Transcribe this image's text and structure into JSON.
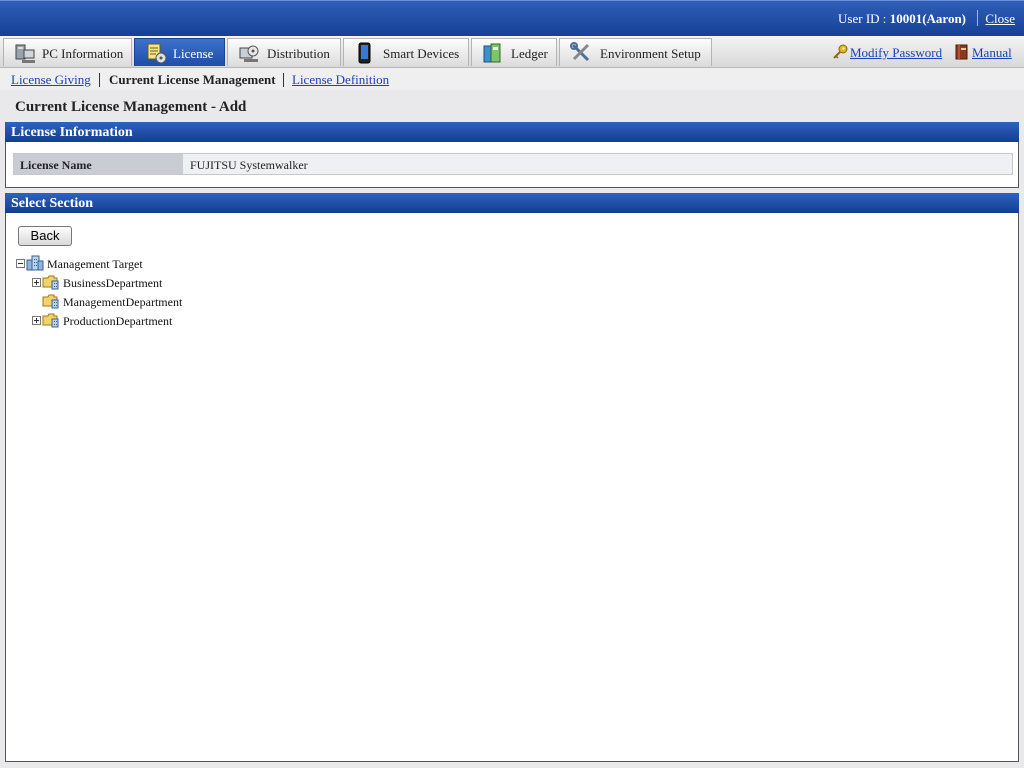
{
  "header": {
    "user_id_label": "User ID : ",
    "user_id_value": "10001(Aaron)",
    "close_label": "Close"
  },
  "tabs": [
    {
      "label": "PC Information",
      "icon": "computer-icon",
      "active": false
    },
    {
      "label": "License",
      "icon": "license-icon",
      "active": true
    },
    {
      "label": "Distribution",
      "icon": "distribution-icon",
      "active": false
    },
    {
      "label": "Smart Devices",
      "icon": "smart-device-icon",
      "active": false
    },
    {
      "label": "Ledger",
      "icon": "ledger-icon",
      "active": false
    },
    {
      "label": "Environment Setup",
      "icon": "tools-icon",
      "active": false
    }
  ],
  "top_links": {
    "modify_password": "Modify Password",
    "manual": "Manual"
  },
  "subnav": {
    "license_giving": "License Giving",
    "current_license_management": "Current License Management",
    "license_definition": "License Definition"
  },
  "page_title": "Current License Management - Add",
  "license_info": {
    "header": "License Information",
    "name_label": "License Name",
    "name_value": "FUJITSU Systemwalker"
  },
  "select_section": {
    "header": "Select Section",
    "back_label": "Back",
    "tree": {
      "root": "Management Target",
      "children": [
        {
          "label": "BusinessDepartment",
          "expandable": true
        },
        {
          "label": "ManagementDepartment",
          "expandable": false
        },
        {
          "label": "ProductionDepartment",
          "expandable": true
        }
      ]
    }
  },
  "colors": {
    "header_blue": "#1d4ea8",
    "link_blue": "#1a43b5"
  }
}
